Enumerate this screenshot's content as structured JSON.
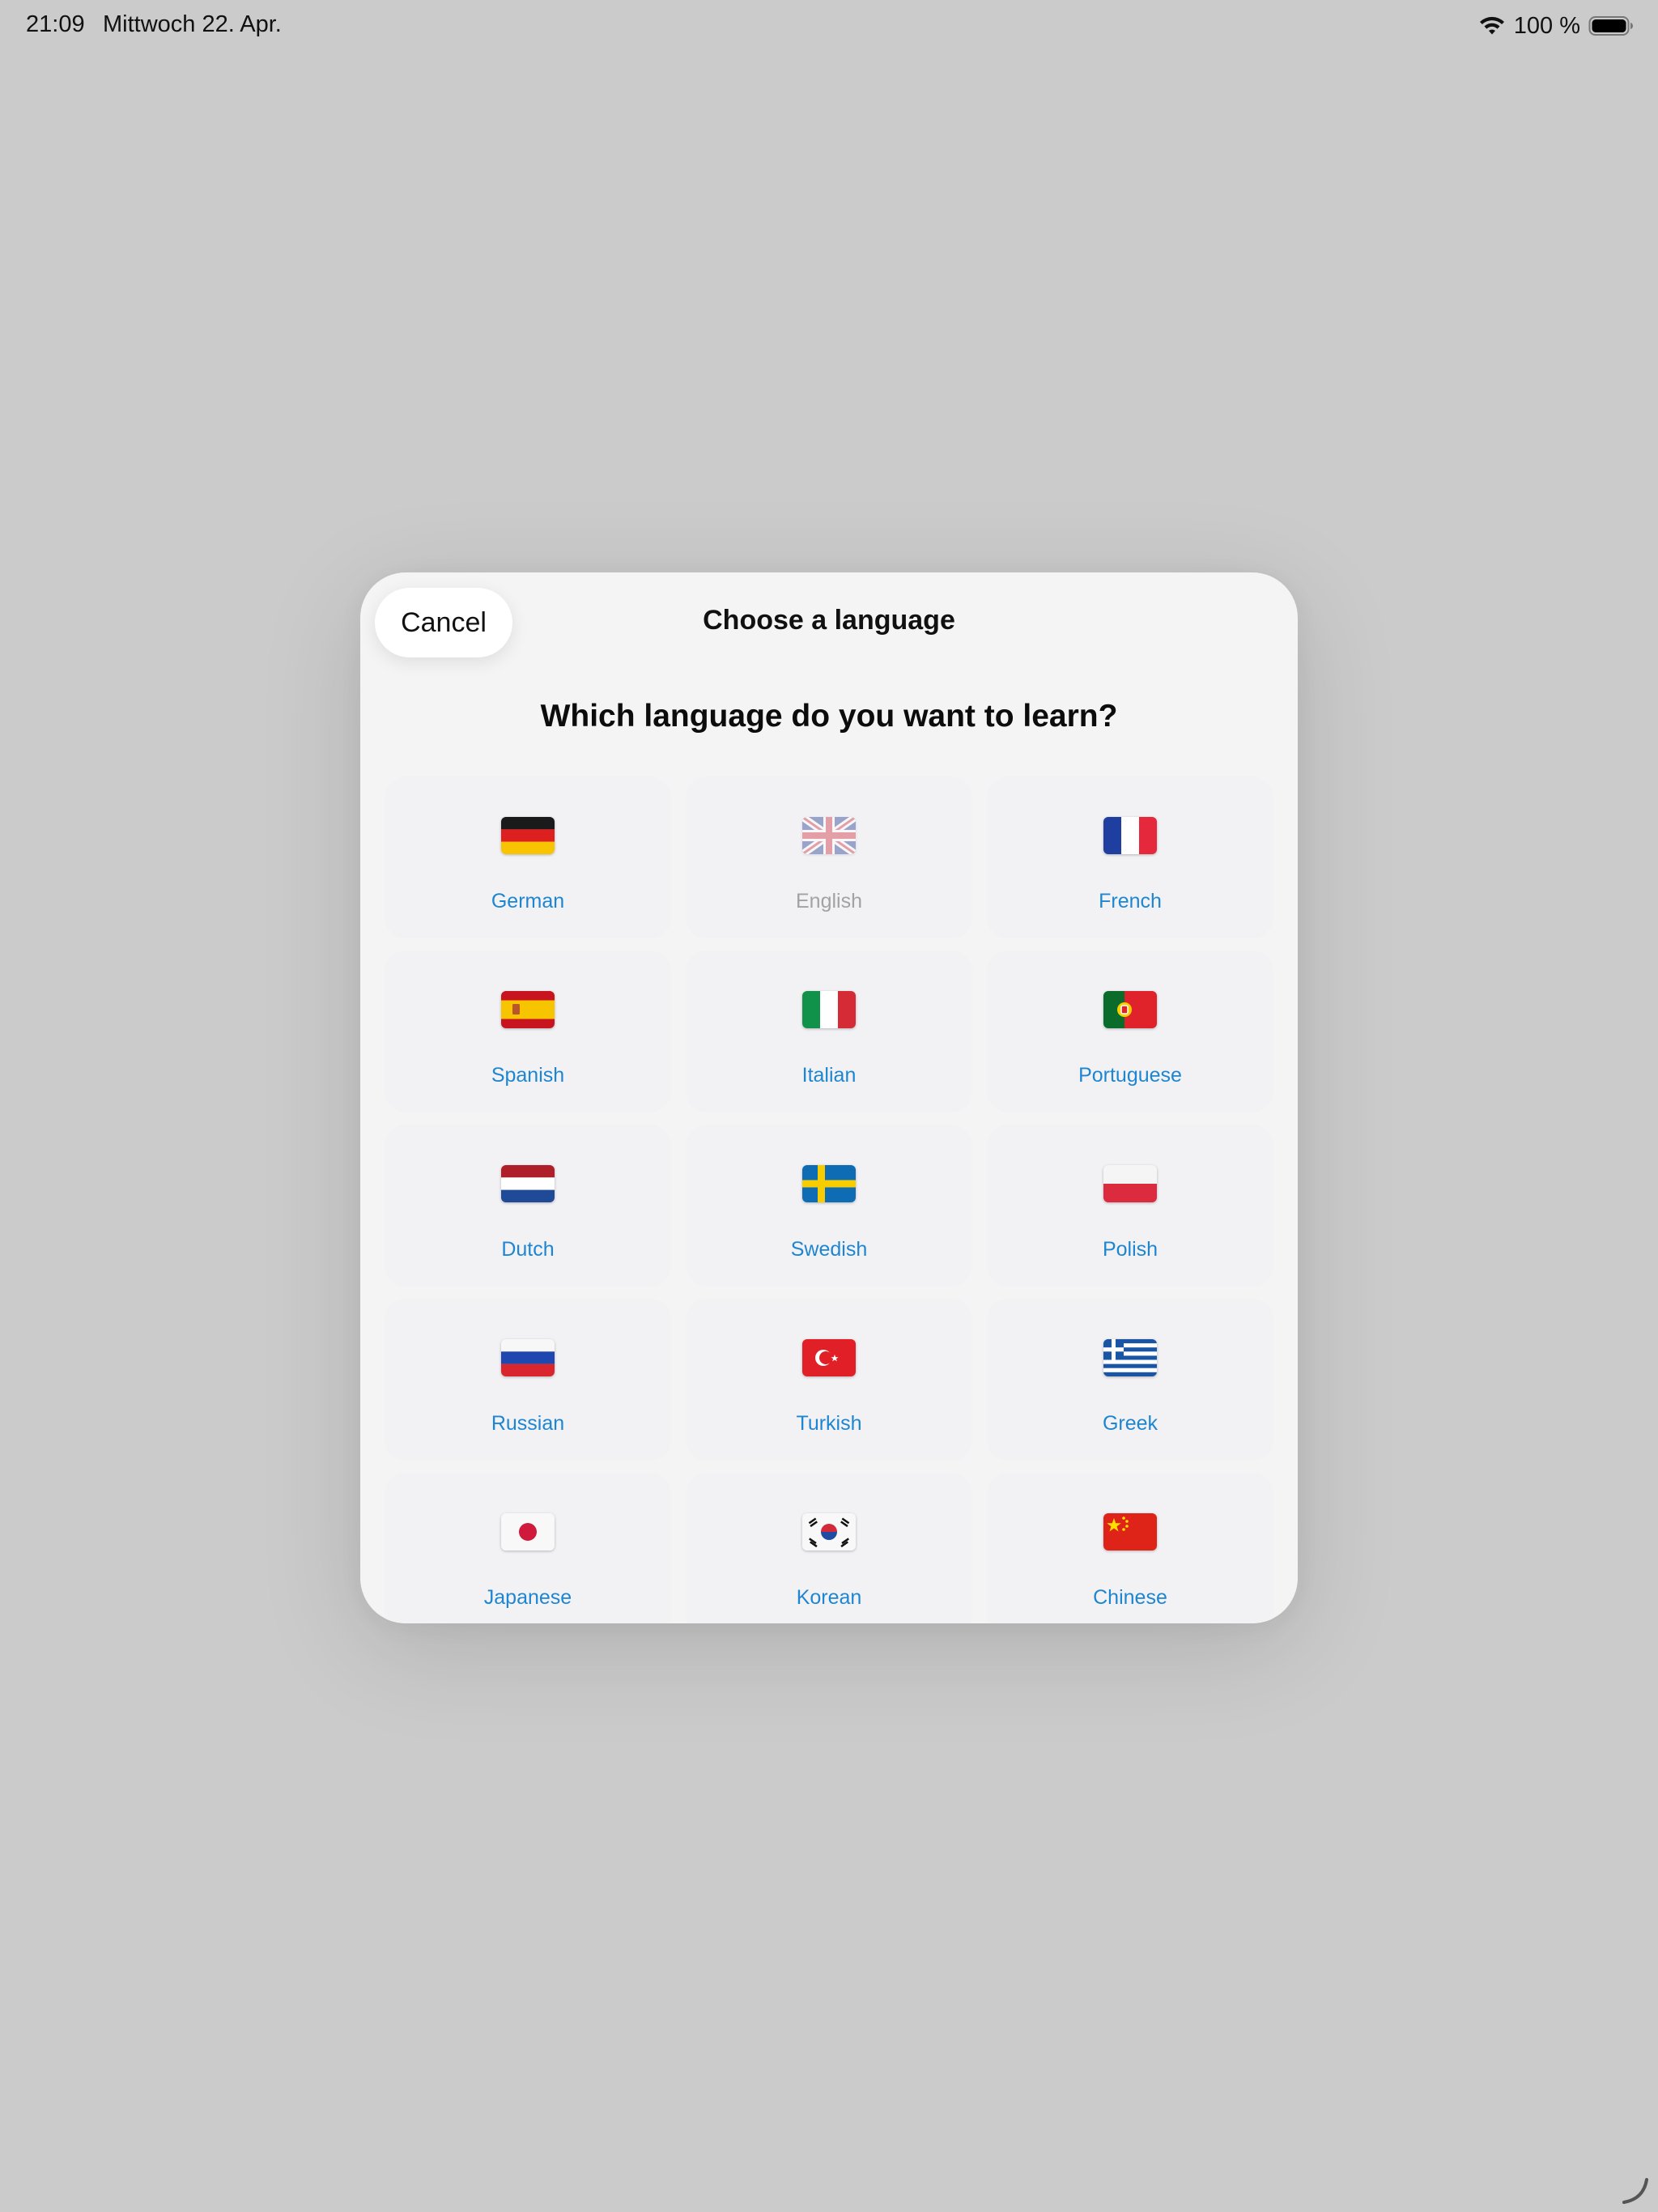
{
  "status_bar": {
    "time": "21:09",
    "date": "Mittwoch 22. Apr.",
    "battery_text": "100 %",
    "icons": [
      "wifi-icon",
      "battery-icon"
    ]
  },
  "modal": {
    "cancel_label": "Cancel",
    "title": "Choose a language",
    "question": "Which language do you want to learn?"
  },
  "languages": [
    {
      "label": "German",
      "flag": "flag-germany-icon",
      "enabled": true
    },
    {
      "label": "English",
      "flag": "flag-uk-icon",
      "enabled": false
    },
    {
      "label": "French",
      "flag": "flag-france-icon",
      "enabled": true
    },
    {
      "label": "Spanish",
      "flag": "flag-spain-icon",
      "enabled": true
    },
    {
      "label": "Italian",
      "flag": "flag-italy-icon",
      "enabled": true
    },
    {
      "label": "Portuguese",
      "flag": "flag-portugal-icon",
      "enabled": true
    },
    {
      "label": "Dutch",
      "flag": "flag-netherlands-icon",
      "enabled": true
    },
    {
      "label": "Swedish",
      "flag": "flag-sweden-icon",
      "enabled": true
    },
    {
      "label": "Polish",
      "flag": "flag-poland-icon",
      "enabled": true
    },
    {
      "label": "Russian",
      "flag": "flag-russia-icon",
      "enabled": true
    },
    {
      "label": "Turkish",
      "flag": "flag-turkey-icon",
      "enabled": true
    },
    {
      "label": "Greek",
      "flag": "flag-greece-icon",
      "enabled": true
    },
    {
      "label": "Japanese",
      "flag": "flag-japan-icon",
      "enabled": true
    },
    {
      "label": "Korean",
      "flag": "flag-korea-icon",
      "enabled": true
    },
    {
      "label": "Chinese",
      "flag": "flag-china-icon",
      "enabled": true
    }
  ],
  "colors": {
    "background": "#cbcbcb",
    "modal": "#f4f4f4",
    "cell": "#f2f2f5",
    "link_blue": "#1e86d1",
    "disabled_gray": "#a2a2a4"
  }
}
